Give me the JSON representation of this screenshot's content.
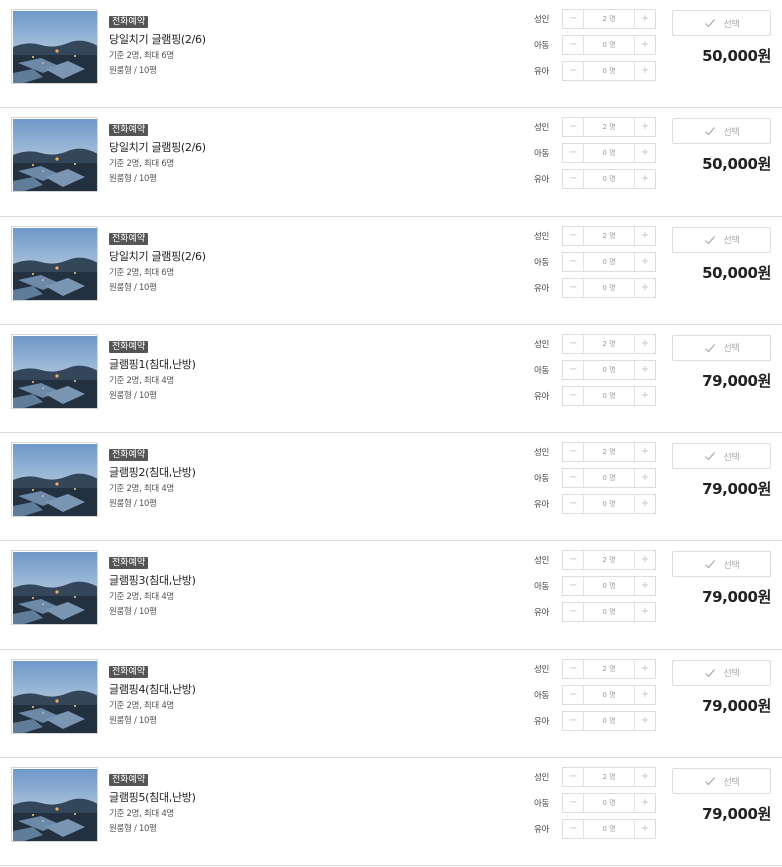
{
  "labels": {
    "adult": "성인",
    "child": "아동",
    "infant": "유아",
    "select": "선택",
    "minus": "−",
    "plus": "+"
  },
  "rooms": [
    {
      "badge": "전화예약",
      "name": "당일치기 글램핑(2/6)",
      "capacity": "기준 2명, 최대 6명",
      "type": "원룸형 / 10평",
      "adult": "2 명",
      "child": "0 명",
      "infant": "0 명",
      "price": "50,000원"
    },
    {
      "badge": "전화예약",
      "name": "당일치기 글램핑(2/6)",
      "capacity": "기준 2명, 최대 6명",
      "type": "원룸형 / 10평",
      "adult": "2 명",
      "child": "0 명",
      "infant": "0 명",
      "price": "50,000원"
    },
    {
      "badge": "전화예약",
      "name": "당일치기 글램핑(2/6)",
      "capacity": "기준 2명, 최대 6명",
      "type": "원룸형 / 10평",
      "adult": "2 명",
      "child": "0 명",
      "infant": "0 명",
      "price": "50,000원"
    },
    {
      "badge": "전화예약",
      "name": "글램핑1(침대,난방)",
      "capacity": "기준 2명, 최대 4명",
      "type": "원룸형 / 10평",
      "adult": "2 명",
      "child": "0 명",
      "infant": "0 명",
      "price": "79,000원"
    },
    {
      "badge": "전화예약",
      "name": "글램핑2(침대,난방)",
      "capacity": "기준 2명, 최대 4명",
      "type": "원룸형 / 10평",
      "adult": "2 명",
      "child": "0 명",
      "infant": "0 명",
      "price": "79,000원"
    },
    {
      "badge": "전화예약",
      "name": "글램핑3(침대,난방)",
      "capacity": "기준 2명, 최대 4명",
      "type": "원룸형 / 10평",
      "adult": "2 명",
      "child": "0 명",
      "infant": "0 명",
      "price": "79,000원"
    },
    {
      "badge": "전화예약",
      "name": "글램핑4(침대,난방)",
      "capacity": "기준 2명, 최대 4명",
      "type": "원룸형 / 10평",
      "adult": "2 명",
      "child": "0 명",
      "infant": "0 명",
      "price": "79,000원"
    },
    {
      "badge": "전화예약",
      "name": "글램핑5(침대,난방)",
      "capacity": "기준 2명, 최대 4명",
      "type": "원룸형 / 10평",
      "adult": "2 명",
      "child": "0 명",
      "infant": "0 명",
      "price": "79,000원"
    }
  ],
  "colors": {
    "badge_bg": "#555555",
    "price": "#222222",
    "border": "#dcdcdc"
  }
}
